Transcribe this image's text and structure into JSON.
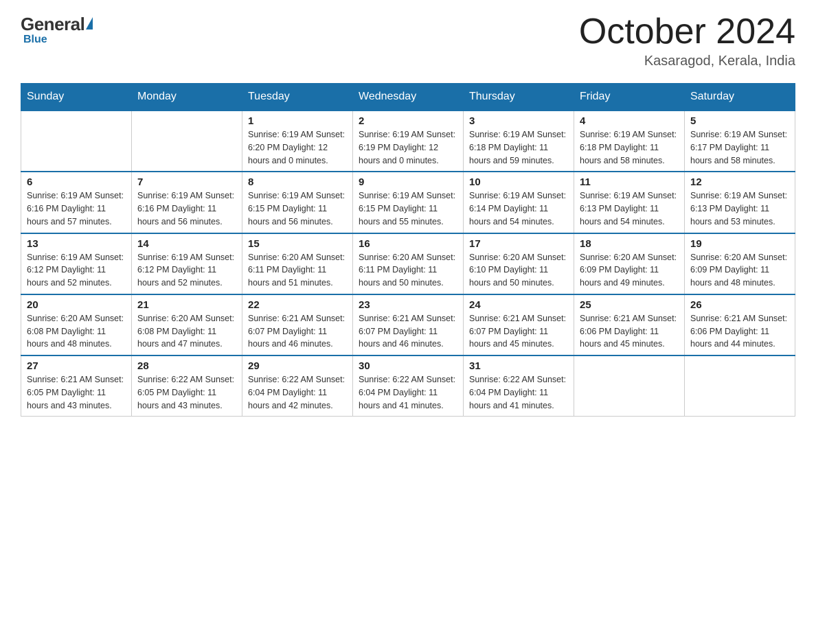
{
  "logo": {
    "general": "General",
    "blue": "Blue",
    "triangle": "▶"
  },
  "header": {
    "month_year": "October 2024",
    "location": "Kasaragod, Kerala, India"
  },
  "days_of_week": [
    "Sunday",
    "Monday",
    "Tuesday",
    "Wednesday",
    "Thursday",
    "Friday",
    "Saturday"
  ],
  "weeks": [
    [
      {
        "day": "",
        "info": ""
      },
      {
        "day": "",
        "info": ""
      },
      {
        "day": "1",
        "info": "Sunrise: 6:19 AM\nSunset: 6:20 PM\nDaylight: 12 hours\nand 0 minutes."
      },
      {
        "day": "2",
        "info": "Sunrise: 6:19 AM\nSunset: 6:19 PM\nDaylight: 12 hours\nand 0 minutes."
      },
      {
        "day": "3",
        "info": "Sunrise: 6:19 AM\nSunset: 6:18 PM\nDaylight: 11 hours\nand 59 minutes."
      },
      {
        "day": "4",
        "info": "Sunrise: 6:19 AM\nSunset: 6:18 PM\nDaylight: 11 hours\nand 58 minutes."
      },
      {
        "day": "5",
        "info": "Sunrise: 6:19 AM\nSunset: 6:17 PM\nDaylight: 11 hours\nand 58 minutes."
      }
    ],
    [
      {
        "day": "6",
        "info": "Sunrise: 6:19 AM\nSunset: 6:16 PM\nDaylight: 11 hours\nand 57 minutes."
      },
      {
        "day": "7",
        "info": "Sunrise: 6:19 AM\nSunset: 6:16 PM\nDaylight: 11 hours\nand 56 minutes."
      },
      {
        "day": "8",
        "info": "Sunrise: 6:19 AM\nSunset: 6:15 PM\nDaylight: 11 hours\nand 56 minutes."
      },
      {
        "day": "9",
        "info": "Sunrise: 6:19 AM\nSunset: 6:15 PM\nDaylight: 11 hours\nand 55 minutes."
      },
      {
        "day": "10",
        "info": "Sunrise: 6:19 AM\nSunset: 6:14 PM\nDaylight: 11 hours\nand 54 minutes."
      },
      {
        "day": "11",
        "info": "Sunrise: 6:19 AM\nSunset: 6:13 PM\nDaylight: 11 hours\nand 54 minutes."
      },
      {
        "day": "12",
        "info": "Sunrise: 6:19 AM\nSunset: 6:13 PM\nDaylight: 11 hours\nand 53 minutes."
      }
    ],
    [
      {
        "day": "13",
        "info": "Sunrise: 6:19 AM\nSunset: 6:12 PM\nDaylight: 11 hours\nand 52 minutes."
      },
      {
        "day": "14",
        "info": "Sunrise: 6:19 AM\nSunset: 6:12 PM\nDaylight: 11 hours\nand 52 minutes."
      },
      {
        "day": "15",
        "info": "Sunrise: 6:20 AM\nSunset: 6:11 PM\nDaylight: 11 hours\nand 51 minutes."
      },
      {
        "day": "16",
        "info": "Sunrise: 6:20 AM\nSunset: 6:11 PM\nDaylight: 11 hours\nand 50 minutes."
      },
      {
        "day": "17",
        "info": "Sunrise: 6:20 AM\nSunset: 6:10 PM\nDaylight: 11 hours\nand 50 minutes."
      },
      {
        "day": "18",
        "info": "Sunrise: 6:20 AM\nSunset: 6:09 PM\nDaylight: 11 hours\nand 49 minutes."
      },
      {
        "day": "19",
        "info": "Sunrise: 6:20 AM\nSunset: 6:09 PM\nDaylight: 11 hours\nand 48 minutes."
      }
    ],
    [
      {
        "day": "20",
        "info": "Sunrise: 6:20 AM\nSunset: 6:08 PM\nDaylight: 11 hours\nand 48 minutes."
      },
      {
        "day": "21",
        "info": "Sunrise: 6:20 AM\nSunset: 6:08 PM\nDaylight: 11 hours\nand 47 minutes."
      },
      {
        "day": "22",
        "info": "Sunrise: 6:21 AM\nSunset: 6:07 PM\nDaylight: 11 hours\nand 46 minutes."
      },
      {
        "day": "23",
        "info": "Sunrise: 6:21 AM\nSunset: 6:07 PM\nDaylight: 11 hours\nand 46 minutes."
      },
      {
        "day": "24",
        "info": "Sunrise: 6:21 AM\nSunset: 6:07 PM\nDaylight: 11 hours\nand 45 minutes."
      },
      {
        "day": "25",
        "info": "Sunrise: 6:21 AM\nSunset: 6:06 PM\nDaylight: 11 hours\nand 45 minutes."
      },
      {
        "day": "26",
        "info": "Sunrise: 6:21 AM\nSunset: 6:06 PM\nDaylight: 11 hours\nand 44 minutes."
      }
    ],
    [
      {
        "day": "27",
        "info": "Sunrise: 6:21 AM\nSunset: 6:05 PM\nDaylight: 11 hours\nand 43 minutes."
      },
      {
        "day": "28",
        "info": "Sunrise: 6:22 AM\nSunset: 6:05 PM\nDaylight: 11 hours\nand 43 minutes."
      },
      {
        "day": "29",
        "info": "Sunrise: 6:22 AM\nSunset: 6:04 PM\nDaylight: 11 hours\nand 42 minutes."
      },
      {
        "day": "30",
        "info": "Sunrise: 6:22 AM\nSunset: 6:04 PM\nDaylight: 11 hours\nand 41 minutes."
      },
      {
        "day": "31",
        "info": "Sunrise: 6:22 AM\nSunset: 6:04 PM\nDaylight: 11 hours\nand 41 minutes."
      },
      {
        "day": "",
        "info": ""
      },
      {
        "day": "",
        "info": ""
      }
    ]
  ]
}
